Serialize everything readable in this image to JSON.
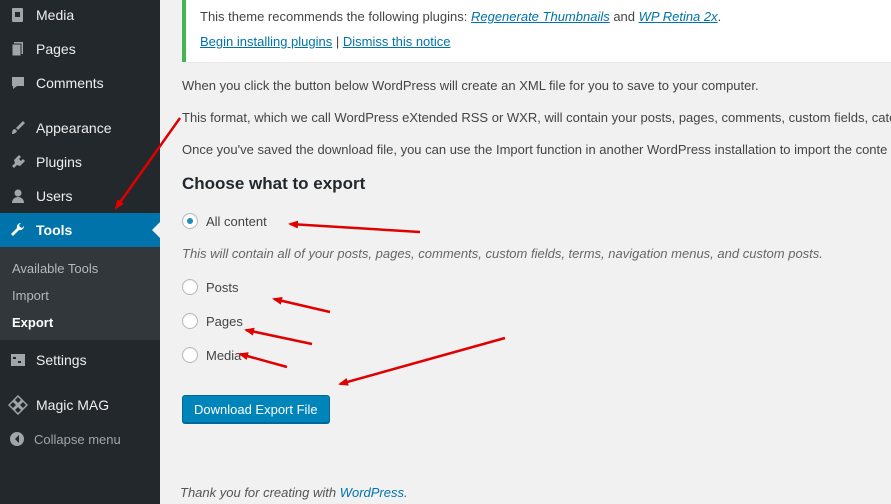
{
  "sidebar": {
    "items": [
      {
        "label": "Media",
        "icon": "media-icon"
      },
      {
        "label": "Pages",
        "icon": "pages-icon"
      },
      {
        "label": "Comments",
        "icon": "comments-icon"
      },
      {
        "label": "Appearance",
        "icon": "appearance-icon"
      },
      {
        "label": "Plugins",
        "icon": "plugins-icon"
      },
      {
        "label": "Users",
        "icon": "users-icon"
      },
      {
        "label": "Tools",
        "icon": "wrench-icon",
        "current": true
      },
      {
        "label": "Settings",
        "icon": "settings-icon"
      },
      {
        "label": "Magic MAG",
        "icon": "magic-mag-icon"
      }
    ],
    "submenu": [
      "Available Tools",
      "Import",
      "Export"
    ],
    "collapse_label": "Collapse menu"
  },
  "notice": {
    "text_before": "This theme recommends the following plugins: ",
    "plugin1": "Regenerate Thumbnails",
    "and": " and ",
    "plugin2": "WP Retina 2x",
    "period": ".",
    "install_link": "Begin installing plugins",
    "separator": " | ",
    "dismiss_link": "Dismiss this notice"
  },
  "intro": {
    "p1": "When you click the button below WordPress will create an XML file for you to save to your computer.",
    "p2": "This format, which we call WordPress eXtended RSS or WXR, will contain your posts, pages, comments, custom fields, catego",
    "p3": "Once you've saved the download file, you can use the Import function in another WordPress installation to import the conte"
  },
  "export": {
    "heading": "Choose what to export",
    "options": [
      "All content",
      "Posts",
      "Pages",
      "Media"
    ],
    "selected": "All content",
    "description": "This will contain all of your posts, pages, comments, custom fields, terms, navigation menus, and custom posts.",
    "button_label": "Download Export File"
  },
  "footer": {
    "text": "Thank you for creating with ",
    "link": "WordPress",
    "period": "."
  },
  "colors": {
    "sidebar_bg": "#23282d",
    "current_menu": "#0073aa",
    "notice_border": "#46b450",
    "button": "#0085ba",
    "annotation_arrow": "#e00000"
  }
}
